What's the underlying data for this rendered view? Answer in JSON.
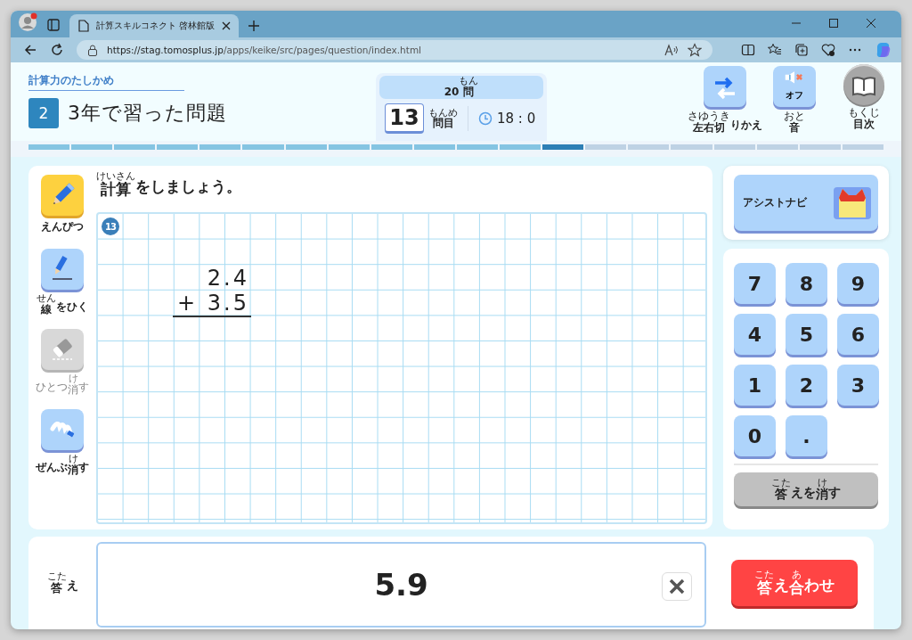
{
  "browser": {
    "tab_title": "計算スキルコネクト 啓林館版",
    "url_host": "https://stag.tomosplus.jp",
    "url_path": "/apps/keike/src/pages/question/index.html"
  },
  "header": {
    "category": "計算力のたしかめ",
    "section_number": "2",
    "section_title": "3年で習った問題",
    "total": [
      {
        "text": "20"
      },
      {
        "text": "問",
        "ruby": "もん"
      }
    ],
    "question_number": "13",
    "question_unit": [
      {
        "text": "問目",
        "ruby": "もんめ"
      }
    ],
    "timer": "18 : 0",
    "buttons": [
      {
        "kind": "swap",
        "label": [
          {
            "text": "左右切",
            "ruby": "さゆうき"
          },
          {
            "text": "りかえ"
          }
        ]
      },
      {
        "kind": "sound",
        "caption": "オフ",
        "label": [
          {
            "text": "音",
            "ruby": "おと"
          }
        ]
      },
      {
        "kind": "contents",
        "label": [
          {
            "text": "目次",
            "ruby": "もくじ"
          }
        ]
      }
    ]
  },
  "progress": [
    {
      "done": true,
      "selected": false
    },
    {
      "done": true,
      "selected": false
    },
    {
      "done": true,
      "selected": false
    },
    {
      "done": true,
      "selected": false
    },
    {
      "done": true,
      "selected": false
    },
    {
      "done": true,
      "selected": false
    },
    {
      "done": true,
      "selected": false
    },
    {
      "done": true,
      "selected": false
    },
    {
      "done": true,
      "selected": false
    },
    {
      "done": true,
      "selected": false
    },
    {
      "done": true,
      "selected": false
    },
    {
      "done": true,
      "selected": false
    },
    {
      "done": false,
      "selected": true
    },
    {
      "done": false,
      "selected": false
    },
    {
      "done": false,
      "selected": false
    },
    {
      "done": false,
      "selected": false
    },
    {
      "done": false,
      "selected": false
    },
    {
      "done": false,
      "selected": false
    },
    {
      "done": false,
      "selected": false
    },
    {
      "done": false,
      "selected": false
    }
  ],
  "tools": [
    {
      "kind": "pencil",
      "selected": true,
      "disabled": false,
      "label": [
        {
          "text": "えんぴつ"
        }
      ]
    },
    {
      "kind": "line",
      "selected": false,
      "disabled": false,
      "label": [
        {
          "text": "線",
          "ruby": "せん"
        },
        {
          "text": "をひく"
        }
      ]
    },
    {
      "kind": "eraser",
      "selected": false,
      "disabled": true,
      "label": [
        {
          "text": "ひとつ"
        },
        {
          "text": "消",
          "ruby": "け"
        },
        {
          "text": "す"
        }
      ]
    },
    {
      "kind": "clear",
      "selected": false,
      "disabled": false,
      "label": [
        {
          "text": "ぜんぶ"
        },
        {
          "text": "消",
          "ruby": "け"
        },
        {
          "text": "す"
        }
      ]
    }
  ],
  "instruction": [
    {
      "text": "計算",
      "ruby": "けいさん"
    },
    {
      "text": "をしましょう。"
    }
  ],
  "worksheet": {
    "problem_number": "13",
    "lines": [
      "2.4",
      "+ 3.5"
    ]
  },
  "assist": {
    "label": "アシストナビ"
  },
  "keypad": {
    "keys": [
      "7",
      "8",
      "9",
      "4",
      "5",
      "6",
      "1",
      "2",
      "3",
      "0",
      "."
    ],
    "clear": [
      {
        "text": "答",
        "ruby": "こた"
      },
      {
        "text": "えを"
      },
      {
        "text": "消",
        "ruby": "け"
      },
      {
        "text": "す"
      }
    ]
  },
  "answer": {
    "label": [
      {
        "text": "答",
        "ruby": "こた"
      },
      {
        "text": "え"
      }
    ],
    "value": "5.9",
    "submit": [
      {
        "text": "答",
        "ruby": "こた"
      },
      {
        "text": "え"
      },
      {
        "text": "合",
        "ruby": "あ"
      },
      {
        "text": "わせ"
      }
    ]
  }
}
